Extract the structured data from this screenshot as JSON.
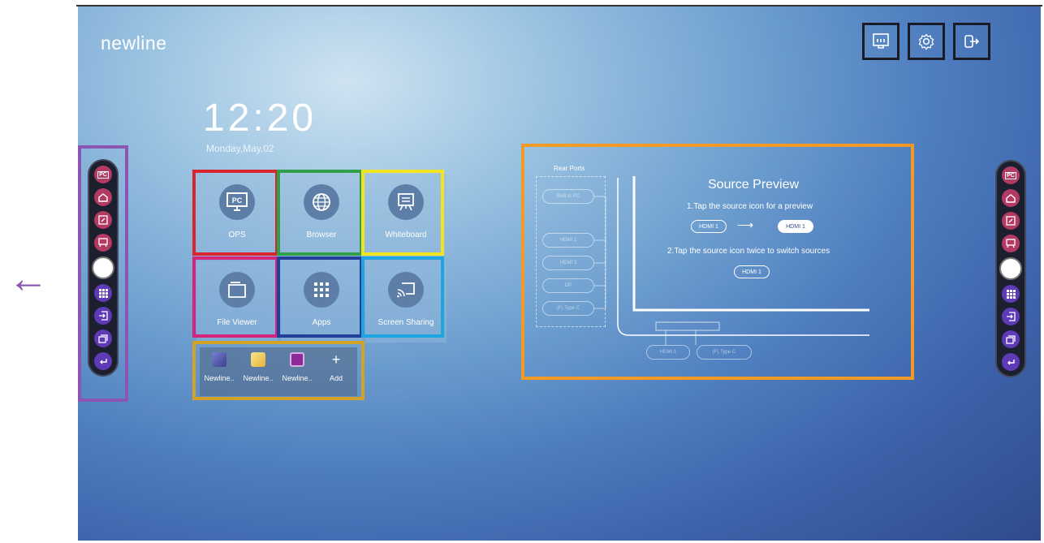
{
  "brand": "newline",
  "clock": {
    "time": "12:20",
    "date": "Monday,May.02"
  },
  "top_buttons": [
    {
      "name": "network-icon"
    },
    {
      "name": "settings-icon"
    },
    {
      "name": "exit-icon"
    }
  ],
  "tiles": [
    {
      "label": "OPS",
      "icon": "pc-icon",
      "icon_text": "PC"
    },
    {
      "label": "Browser",
      "icon": "globe-icon"
    },
    {
      "label": "Whiteboard",
      "icon": "whiteboard-icon"
    },
    {
      "label": "File Viewer",
      "icon": "folder-icon"
    },
    {
      "label": "Apps",
      "icon": "apps-grid-icon"
    },
    {
      "label": "Screen Sharing",
      "icon": "screen-share-icon"
    }
  ],
  "dock": [
    {
      "label": "Newline..",
      "icon": "app-icon-1"
    },
    {
      "label": "Newline..",
      "icon": "app-icon-2"
    },
    {
      "label": "Newline..",
      "icon": "app-icon-3"
    },
    {
      "label": "Add",
      "icon": "plus-icon",
      "glyph": "+"
    }
  ],
  "toolbar": {
    "items": [
      "pc-icon",
      "home-icon",
      "annotate-icon",
      "whiteboard-icon",
      "home-button",
      "apps-icon",
      "input-icon",
      "windows-icon",
      "back-icon"
    ],
    "pc_text": "PC"
  },
  "source_preview": {
    "rear_ports_title": "Rear Ports",
    "rear_ports": [
      "Built-in PC",
      "HDMI 2",
      "HDMI 3",
      "DP",
      "(F) Type C"
    ],
    "title": "Source Preview",
    "step1": "1.Tap the source icon for a preview",
    "step2": "2.Tap the source icon twice to switch sources",
    "demo_source": "HDMI 1",
    "demo_result": "HDMI 1",
    "arrow": "⟶",
    "front_ports": [
      "HDMI 1",
      "(F) Type C"
    ]
  },
  "colors": {
    "ops": "#d9252e",
    "browser": "#2fa04a",
    "whiteboard": "#f2e421",
    "file_viewer": "#d6247c",
    "apps": "#22409a",
    "screen_sharing": "#1ea5e0",
    "dock": "#d4a226",
    "toolbar_frame": "#8a55b3",
    "preview": "#f29a26",
    "arrow": "#8a55b3"
  },
  "left_arrow": "←"
}
